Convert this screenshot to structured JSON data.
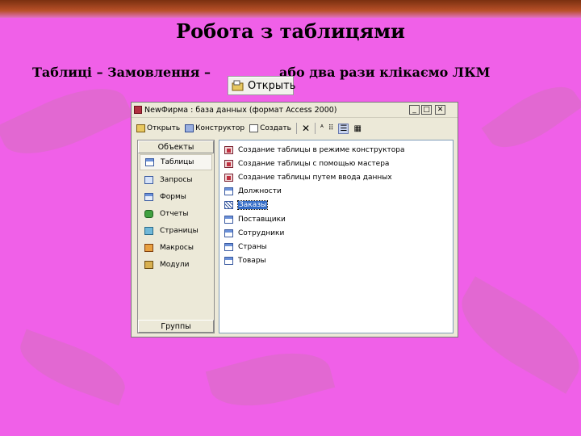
{
  "slide": {
    "title": "Робота з таблицями",
    "text_left": "Таблиці – Замовлення –",
    "text_right": "або два рази клікаємо ЛКМ"
  },
  "callout": {
    "label": "Открыть",
    "icon": "open-icon"
  },
  "window": {
    "title": "Фирма : база данных (формат Access 2000)",
    "title_prefix": "New",
    "toolbar": [
      {
        "label": "Открыть",
        "icon": "open-icon"
      },
      {
        "label": "Конструктор",
        "icon": "design-icon"
      },
      {
        "label": "Создать",
        "icon": "new-icon"
      }
    ],
    "objects_header": "Объекты",
    "groups_label": "Группы",
    "objects": [
      {
        "label": "Таблицы",
        "icon": "table-icon",
        "selected": true
      },
      {
        "label": "Запросы",
        "icon": "query-icon"
      },
      {
        "label": "Формы",
        "icon": "form-icon"
      },
      {
        "label": "Отчеты",
        "icon": "report-icon"
      },
      {
        "label": "Страницы",
        "icon": "page-icon"
      },
      {
        "label": "Макросы",
        "icon": "macro-icon"
      },
      {
        "label": "Модули",
        "icon": "module-icon"
      }
    ],
    "items": [
      {
        "label": "Создание таблицы в режиме конструктора",
        "icon": "create-icon"
      },
      {
        "label": "Создание таблицы с помощью мастера",
        "icon": "create-icon"
      },
      {
        "label": "Создание таблицы путем ввода данных",
        "icon": "create-icon"
      },
      {
        "label": "Должности",
        "icon": "table-icon"
      },
      {
        "label": "Заказы",
        "icon": "table-icon",
        "selected": true
      },
      {
        "label": "Поставщики",
        "icon": "table-icon"
      },
      {
        "label": "Сотрудники",
        "icon": "table-icon"
      },
      {
        "label": "Страны",
        "icon": "table-icon"
      },
      {
        "label": "Товары",
        "icon": "table-icon"
      }
    ]
  },
  "colors": {
    "background": "#f060e8",
    "selection": "#316ac5",
    "window": "#ece9d8"
  }
}
